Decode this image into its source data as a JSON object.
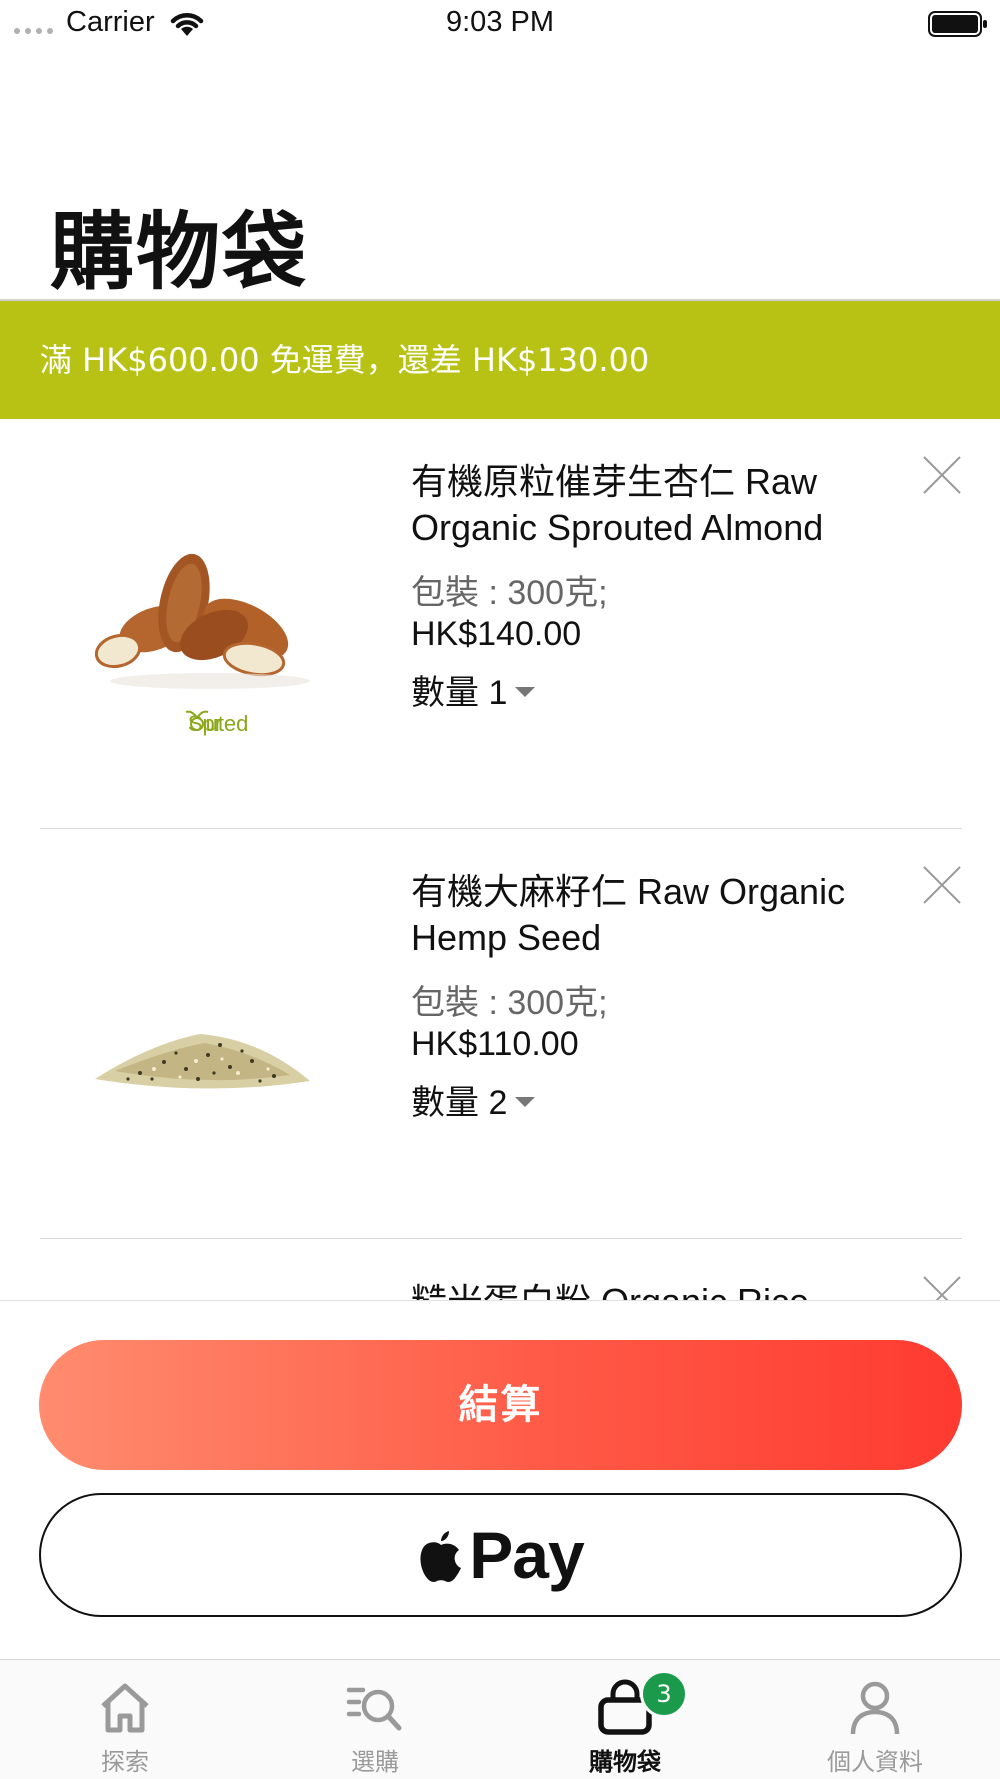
{
  "status_bar": {
    "carrier": "Carrier",
    "time": "9:03 PM"
  },
  "page_title": "購物袋",
  "shipping_banner": {
    "text": "滿 HK$600.00 免運費，還差 HK$130.00",
    "color": "#b8c214"
  },
  "cart": {
    "items": [
      {
        "name": "有機原粒催芽生杏仁 Raw Organic Sprouted Almond",
        "package": "包裝 : 300克;",
        "price": "HK$140.00",
        "quantity": "數量 1",
        "image_logo_text": "Sprouted",
        "icon": "close-icon"
      },
      {
        "name": "有機大麻籽仁 Raw Organic Hemp Seed",
        "package": "包裝 : 300克;",
        "price": "HK$110.00",
        "quantity": "數量 2",
        "icon": "close-icon"
      },
      {
        "name": "糙米蛋白粉 Organic Rice",
        "icon": "close-icon"
      }
    ]
  },
  "checkout": {
    "label": "結算",
    "gradient": [
      "#ff8c6e",
      "#ff3a30"
    ]
  },
  "apple_pay": {
    "label": "Pay",
    "icon": "apple-logo-icon"
  },
  "tab_bar": {
    "tabs": [
      {
        "label": "探索",
        "icon": "home-icon",
        "active": false
      },
      {
        "label": "選購",
        "icon": "search-list-icon",
        "active": false
      },
      {
        "label": "購物袋",
        "icon": "bag-icon",
        "active": true,
        "badge": "3"
      },
      {
        "label": "個人資料",
        "icon": "person-icon",
        "active": false
      }
    ],
    "badge_color": "#1a9a4a"
  }
}
